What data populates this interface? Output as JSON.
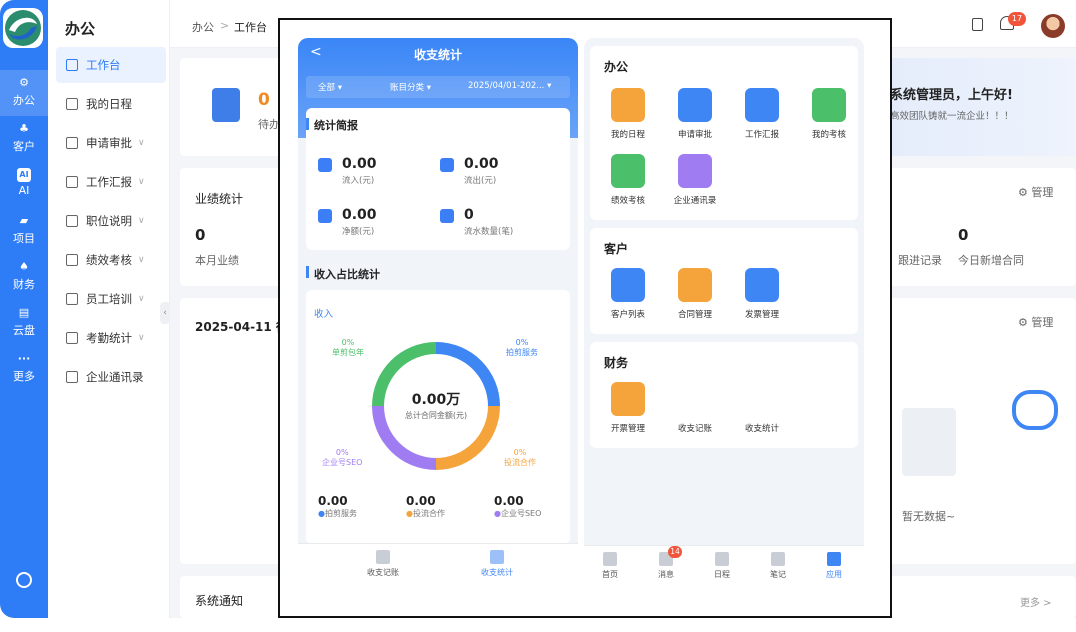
{
  "rail": {
    "items": [
      {
        "label": "办公",
        "icon": "office-icon"
      },
      {
        "label": "客户",
        "icon": "customer-icon"
      },
      {
        "label": "AI",
        "icon": "ai-icon",
        "badge": "AI"
      },
      {
        "label": "项目",
        "icon": "folder-icon"
      },
      {
        "label": "财务",
        "icon": "finance-icon"
      },
      {
        "label": "云盘",
        "icon": "cloud-disk-icon"
      },
      {
        "label": "更多",
        "icon": "more-icon",
        "glyph": "···"
      }
    ]
  },
  "sidebar": {
    "title": "办公",
    "items": [
      {
        "label": "工作台",
        "active": true
      },
      {
        "label": "我的日程"
      },
      {
        "label": "申请审批",
        "expand": true
      },
      {
        "label": "工作汇报",
        "expand": true
      },
      {
        "label": "职位说明",
        "expand": true
      },
      {
        "label": "绩效考核",
        "expand": true
      },
      {
        "label": "员工培训",
        "expand": true
      },
      {
        "label": "考勤统计",
        "expand": true
      },
      {
        "label": "企业通讯录"
      }
    ],
    "chevron": "∨"
  },
  "header": {
    "breadcrumb": [
      "办公",
      "工作台"
    ],
    "breadcrumb_sep": ">",
    "notification_count": "17"
  },
  "dashboard": {
    "todo_value": "0",
    "todo_label": "待办",
    "perf_title": "业绩统计",
    "perf_value": "0",
    "perf_label": "本月业绩",
    "date_title": "2025-04-11 待",
    "greeting": "系统管理员，上午好!",
    "slogan": "高效团队铸就一流企业！！！",
    "manage": "管理",
    "follow_label": "跟进记录",
    "new_contract_value": "0",
    "new_contract_label": "今日新增合同",
    "empty": "暂无数据~",
    "notice_title": "系统通知",
    "more": "更多 >",
    "watermark": "系统管理员"
  },
  "phoneA": {
    "title": "收支统计",
    "back": "<",
    "filters": [
      "全部 ▾",
      "账目分类 ▾",
      "2025/04/01-202... ▾"
    ],
    "summary_title": "统计简报",
    "stats": [
      {
        "value": "0.00",
        "label": "流入(元)"
      },
      {
        "value": "0.00",
        "label": "流出(元)"
      },
      {
        "value": "0.00",
        "label": "净额(元)"
      },
      {
        "value": "0",
        "label": "流水数量(笔)"
      }
    ],
    "ratio_title": "收入占比统计",
    "income_tab": "收入",
    "donut": {
      "center_value": "0.00万",
      "center_label": "总计合同金额(元)",
      "segments": [
        {
          "name": "拍剪服务",
          "pct": "0%",
          "color": "#3f86f5",
          "value": 0.25
        },
        {
          "name": "投流合作",
          "pct": "0%",
          "color": "#f5a33b",
          "value": 0.25
        },
        {
          "name": "企业号SEO",
          "pct": "0%",
          "color": "#a07cf2",
          "value": 0.25
        },
        {
          "name": "单剪包年",
          "pct": "0%",
          "color": "#4cbf6a",
          "value": 0.25
        }
      ]
    },
    "legend": [
      {
        "value": "0.00",
        "label": "拍剪服务",
        "color": "#3f86f5"
      },
      {
        "value": "0.00",
        "label": "投流合作",
        "color": "#f5a33b"
      },
      {
        "value": "0.00",
        "label": "企业号SEO",
        "color": "#a07cf2"
      }
    ],
    "tabs": [
      {
        "label": "收支记账"
      },
      {
        "label": "收支统计",
        "active": true
      }
    ]
  },
  "phoneB": {
    "groups": [
      {
        "title": "办公",
        "apps": [
          {
            "label": "我的日程",
            "color": "#f5a33b",
            "icon": "calendar-icon"
          },
          {
            "label": "申请审批",
            "color": "#3f86f5",
            "icon": "approval-icon"
          },
          {
            "label": "工作汇报",
            "color": "#3f86f5",
            "icon": "send-icon"
          },
          {
            "label": "我的考核",
            "color": "#4cbf6a",
            "icon": "chart-icon"
          },
          {
            "label": "绩效考核",
            "color": "#4cbf6a",
            "icon": "chart-icon"
          },
          {
            "label": "企业通讯录",
            "color": "#a07cf2",
            "icon": "contacts-icon"
          }
        ]
      },
      {
        "title": "客户",
        "apps": [
          {
            "label": "客户列表",
            "color": "#3f86f5",
            "icon": "customer-list-icon"
          },
          {
            "label": "合同管理",
            "color": "#f5a33b",
            "icon": "contract-icon"
          },
          {
            "label": "发票管理",
            "color": "#3f86f5",
            "icon": "invoice-icon"
          }
        ]
      },
      {
        "title": "财务",
        "apps": [
          {
            "label": "开票管理",
            "color": "#f5a33b",
            "icon": "invoice-issue-icon"
          },
          {
            "label": "收支记账",
            "color": null
          },
          {
            "label": "收支统计",
            "color": null
          }
        ]
      }
    ],
    "tabbar": [
      {
        "label": "首页"
      },
      {
        "label": "消息",
        "badge": "14"
      },
      {
        "label": "日程"
      },
      {
        "label": "笔记"
      },
      {
        "label": "应用",
        "active": true
      }
    ]
  }
}
